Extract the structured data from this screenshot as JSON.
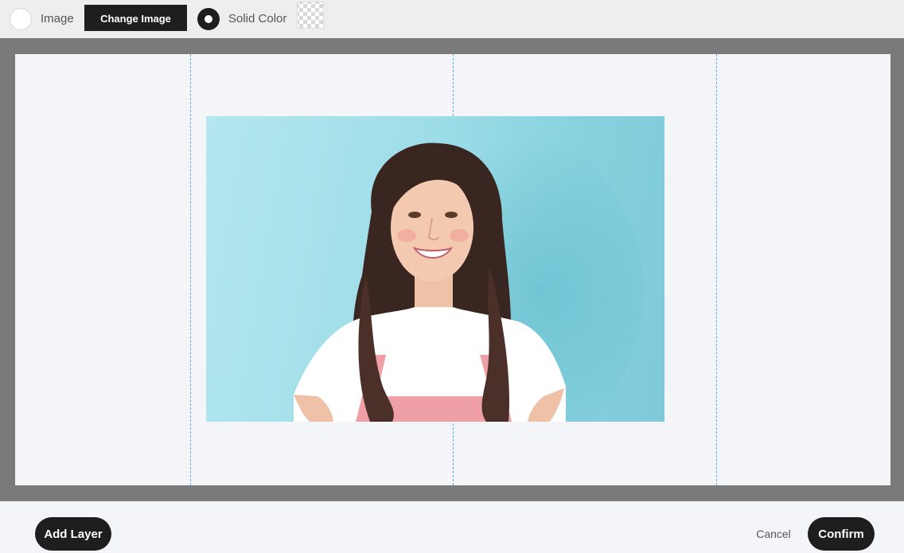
{
  "background_options": {
    "image_label": "Image",
    "change_image_label": "Change Image",
    "solid_color_label": "Solid Color",
    "selected": "Solid Color",
    "swatch_icon": "transparent-checkerboard"
  },
  "canvas": {
    "photo_description_icon": "portrait-photo"
  },
  "footer": {
    "add_layer_label": "Add Layer",
    "cancel_label": "Cancel",
    "confirm_label": "Confirm"
  },
  "colors": {
    "toolbar_bg": "#eeeeee",
    "frame_bg": "#7a7a7b",
    "canvas_bg": "#f4f5f9",
    "button_bg": "#1e1e1e",
    "guide_line": "#5aaee0",
    "photo_bg": "#9ddde8"
  }
}
